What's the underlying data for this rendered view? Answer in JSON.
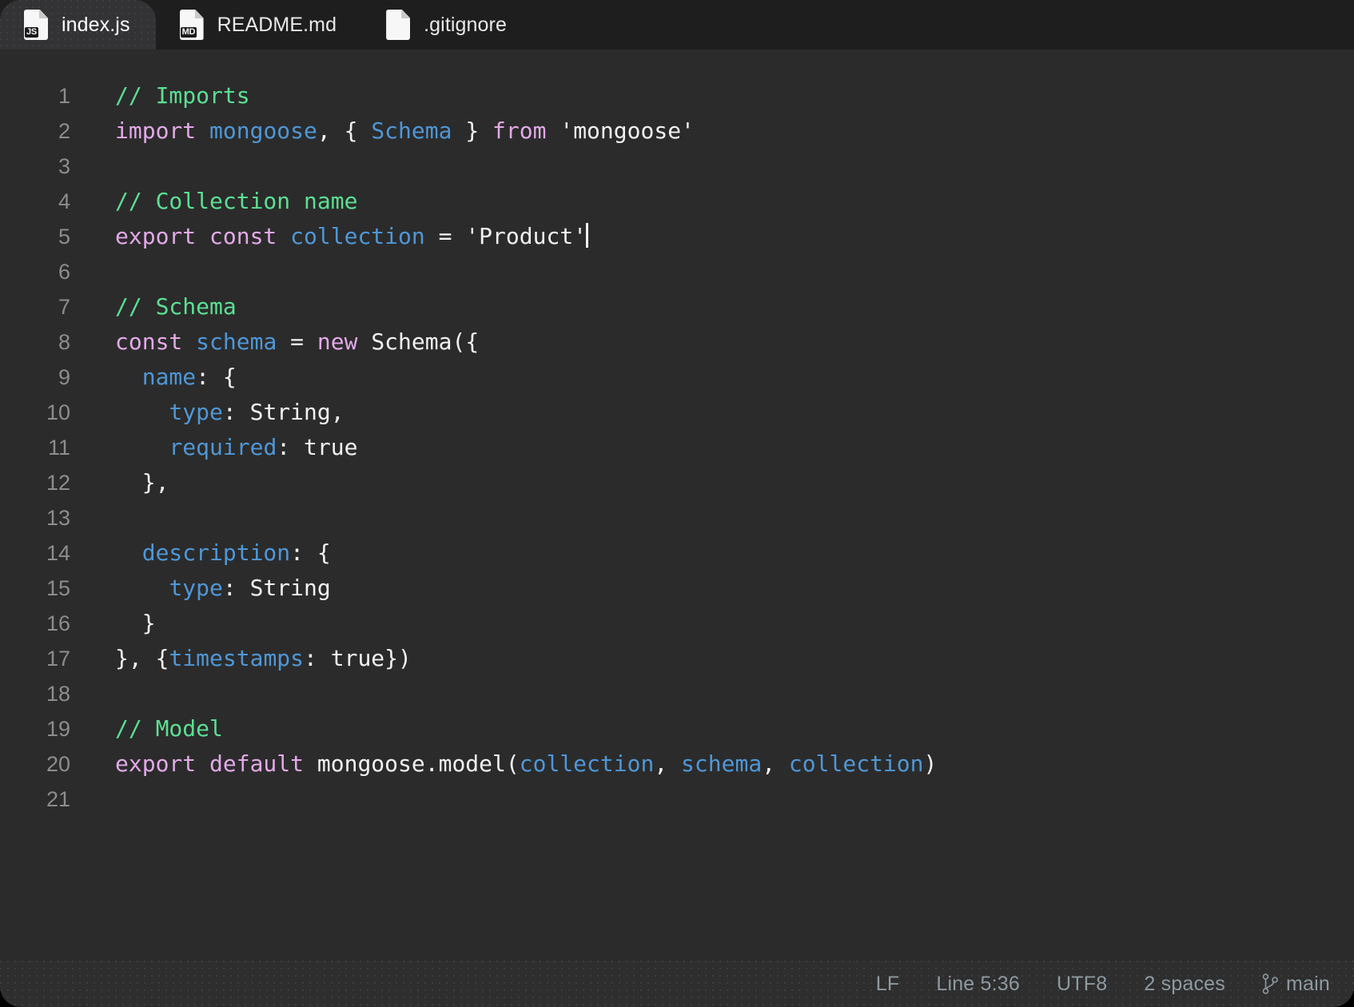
{
  "tabs": [
    {
      "label": "index.js",
      "icon": "js-file-icon",
      "badge": "JS",
      "active": true
    },
    {
      "label": "README.md",
      "icon": "markdown-file-icon",
      "badge": "MD",
      "active": false
    },
    {
      "label": ".gitignore",
      "icon": "plain-file-icon",
      "badge": "",
      "active": false
    }
  ],
  "editor": {
    "language": "javascript",
    "lines": [
      {
        "n": "1",
        "tokens": [
          {
            "t": "// Imports",
            "c": "t-com"
          }
        ]
      },
      {
        "n": "2",
        "tokens": [
          {
            "t": "import ",
            "c": "t-kw"
          },
          {
            "t": "mongoose",
            "c": "t-var"
          },
          {
            "t": ", { ",
            "c": "t-pln"
          },
          {
            "t": "Schema",
            "c": "t-var"
          },
          {
            "t": " } ",
            "c": "t-pln"
          },
          {
            "t": "from ",
            "c": "t-kw"
          },
          {
            "t": "'mongoose'",
            "c": "t-pln"
          }
        ]
      },
      {
        "n": "3",
        "tokens": []
      },
      {
        "n": "4",
        "tokens": [
          {
            "t": "// Collection name",
            "c": "t-com"
          }
        ]
      },
      {
        "n": "5",
        "tokens": [
          {
            "t": "export const ",
            "c": "t-kw"
          },
          {
            "t": "collection",
            "c": "t-var"
          },
          {
            "t": " = ",
            "c": "t-pln"
          },
          {
            "t": "'Product'",
            "c": "t-pln"
          }
        ],
        "cursor": true
      },
      {
        "n": "6",
        "tokens": []
      },
      {
        "n": "7",
        "tokens": [
          {
            "t": "// Schema",
            "c": "t-com"
          }
        ]
      },
      {
        "n": "8",
        "tokens": [
          {
            "t": "const ",
            "c": "t-kw"
          },
          {
            "t": "schema",
            "c": "t-var"
          },
          {
            "t": " = ",
            "c": "t-pln"
          },
          {
            "t": "new ",
            "c": "t-kw"
          },
          {
            "t": "Schema({",
            "c": "t-pln"
          }
        ]
      },
      {
        "n": "9",
        "tokens": [
          {
            "t": "  ",
            "c": "t-pln"
          },
          {
            "t": "name",
            "c": "t-var"
          },
          {
            "t": ": {",
            "c": "t-pln"
          }
        ]
      },
      {
        "n": "10",
        "tokens": [
          {
            "t": "    ",
            "c": "t-pln"
          },
          {
            "t": "type",
            "c": "t-var"
          },
          {
            "t": ": String,",
            "c": "t-pln"
          }
        ]
      },
      {
        "n": "11",
        "tokens": [
          {
            "t": "    ",
            "c": "t-pln"
          },
          {
            "t": "required",
            "c": "t-var"
          },
          {
            "t": ": true",
            "c": "t-pln"
          }
        ]
      },
      {
        "n": "12",
        "tokens": [
          {
            "t": "  },",
            "c": "t-pln"
          }
        ]
      },
      {
        "n": "13",
        "tokens": []
      },
      {
        "n": "14",
        "tokens": [
          {
            "t": "  ",
            "c": "t-pln"
          },
          {
            "t": "description",
            "c": "t-var"
          },
          {
            "t": ": {",
            "c": "t-pln"
          }
        ]
      },
      {
        "n": "15",
        "tokens": [
          {
            "t": "    ",
            "c": "t-pln"
          },
          {
            "t": "type",
            "c": "t-var"
          },
          {
            "t": ": String",
            "c": "t-pln"
          }
        ]
      },
      {
        "n": "16",
        "tokens": [
          {
            "t": "  }",
            "c": "t-pln"
          }
        ]
      },
      {
        "n": "17",
        "tokens": [
          {
            "t": "}, {",
            "c": "t-pln"
          },
          {
            "t": "timestamps",
            "c": "t-var"
          },
          {
            "t": ": true})",
            "c": "t-pln"
          }
        ]
      },
      {
        "n": "18",
        "tokens": []
      },
      {
        "n": "19",
        "tokens": [
          {
            "t": "// Model",
            "c": "t-com"
          }
        ]
      },
      {
        "n": "20",
        "tokens": [
          {
            "t": "export default ",
            "c": "t-kw"
          },
          {
            "t": "mongoose.model(",
            "c": "t-pln"
          },
          {
            "t": "collection",
            "c": "t-var"
          },
          {
            "t": ", ",
            "c": "t-pln"
          },
          {
            "t": "schema",
            "c": "t-var"
          },
          {
            "t": ", ",
            "c": "t-pln"
          },
          {
            "t": "collection",
            "c": "t-var"
          },
          {
            "t": ")",
            "c": "t-pln"
          }
        ]
      },
      {
        "n": "21",
        "tokens": []
      }
    ]
  },
  "statusbar": {
    "line_ending": "LF",
    "cursor_position": "Line 5:36",
    "encoding": "UTF8",
    "indentation": "2 spaces",
    "branch": "main"
  },
  "colors": {
    "editor_bg": "#2b2b2b",
    "tabbar_bg": "#1e1e1e",
    "active_tab_bg": "#333335",
    "statusbar_bg": "#2e2e2f",
    "comment": "#5cdf93",
    "keyword": "#e3a9e8",
    "variable": "#4f97d7",
    "plain": "#f2f2f2",
    "line_number": "#8d8d8d",
    "status_text": "#8e9aa0"
  }
}
